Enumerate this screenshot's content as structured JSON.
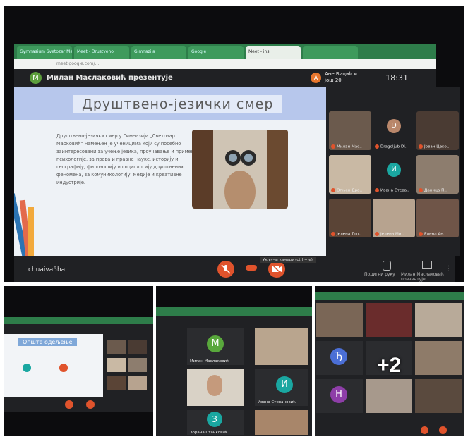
{
  "main_screen": {
    "browser_tabs": [
      "Gymnasium Svetozar Markovic",
      "Meet - Drustveno",
      "Gimnazija",
      "Google",
      "Meet - ins",
      ""
    ],
    "address_bar": "meet.google.com/...",
    "presenter": "Милан Маслаковић презентује",
    "presenter_initial": "М",
    "others_label": "Ане Вицић и још 20",
    "others_initial": "А",
    "time": "18:31",
    "slide": {
      "title": "Друштвено-језички смер",
      "body": "Друштвено-језички смер у Гимназији „Светозар Марковић“ намењен је ученицима који су посебно заинтересовани за учење језика, проучавање и примену психологије, за права и правне науке, историју и географију, филозофију и социологију друштвених феномена, за комуникологију, медије и креативне индустрије."
    },
    "participants": [
      {
        "name": "Милан Мас..",
        "initial": "",
        "bg": "#6b5a4d"
      },
      {
        "name": "Dragoljub Di..",
        "initial": "D",
        "bg": "#202124",
        "circle": "#b9876b"
      },
      {
        "name": "Јован Цеко..",
        "initial": "",
        "bg": "#4a3b33"
      },
      {
        "name": "Огњен Дра..",
        "initial": "",
        "bg": "#c9b9a4"
      },
      {
        "name": "Ивана Стева..",
        "initial": "И",
        "bg": "#202124",
        "circle": "#1aa7a1"
      },
      {
        "name": "Даница П..",
        "initial": "",
        "bg": "#8d7d6e"
      },
      {
        "name": "Јелена Топ..",
        "initial": "",
        "bg": "#5a4436"
      },
      {
        "name": "Јелена Ми..",
        "initial": "",
        "bg": "#b7a38f"
      },
      {
        "name": "Елена Ан..",
        "initial": "",
        "bg": "#6f5548"
      }
    ],
    "controls": {
      "user_label": "chuaiva5ha",
      "raise_hand_label": "Подигни руку",
      "presenting_label": "Милан Маслаковић презентује",
      "tooltip": "Укључи камеру (ctrl + e)"
    }
  },
  "photo_left": {
    "slide_title": "Опште одељење"
  },
  "photo_middle": {
    "tiles": [
      {
        "initial": "М",
        "name": "Милан Маслаковић",
        "color": "#59a83c"
      },
      {
        "initial": "И",
        "name": "Ивана Стевановић",
        "color": "#1aa7a1"
      },
      {
        "initial": "З",
        "name": "Зорана Станковић",
        "color": "#1aa7a1"
      }
    ]
  },
  "photo_right": {
    "overflow_count": "+2",
    "initials": [
      "Ђ",
      "Н"
    ]
  }
}
